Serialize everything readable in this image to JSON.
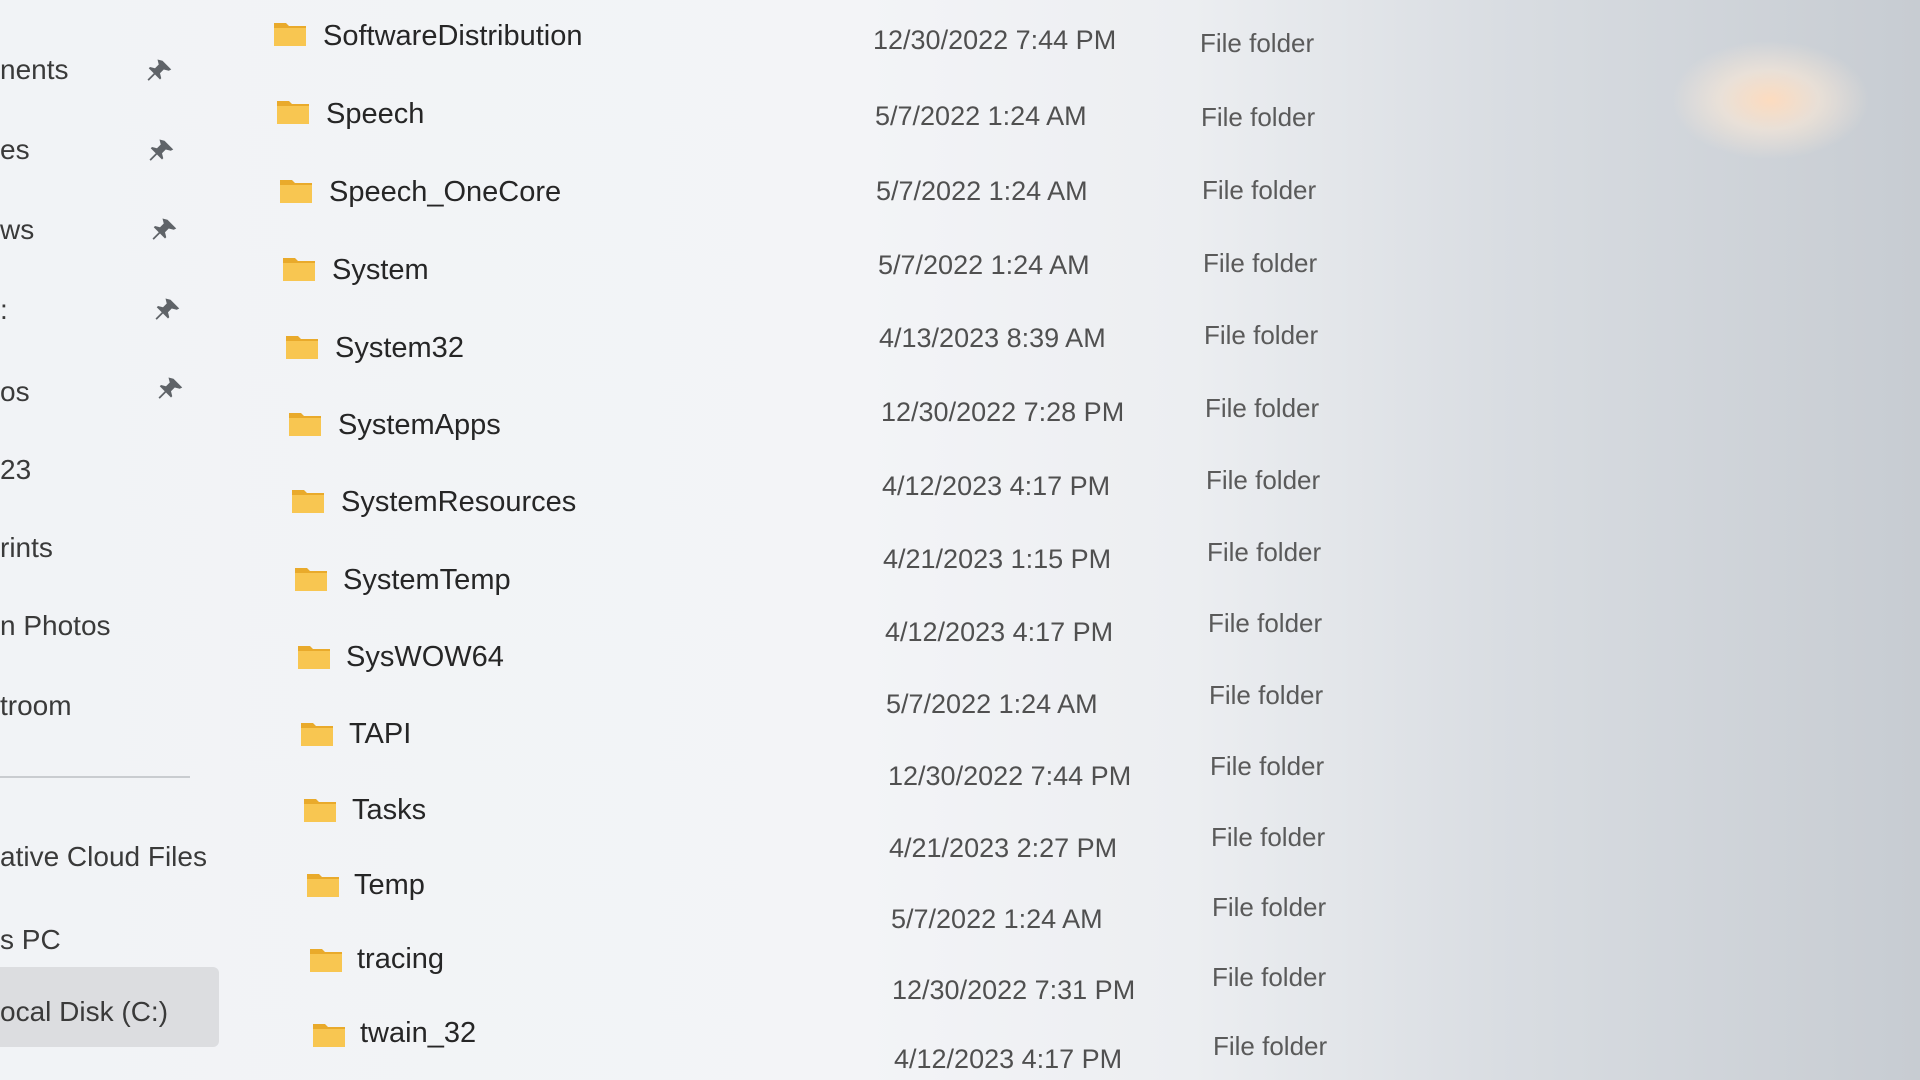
{
  "sidebar": {
    "items": [
      {
        "label": "nents",
        "pinned": true
      },
      {
        "label": "es",
        "pinned": true
      },
      {
        "label": "ws",
        "pinned": true
      },
      {
        "label": ":",
        "pinned": true
      },
      {
        "label": "os",
        "pinned": true
      },
      {
        "label": "23",
        "pinned": false
      },
      {
        "label": "rints",
        "pinned": false
      },
      {
        "label": "n Photos",
        "pinned": false
      },
      {
        "label": "troom",
        "pinned": false
      },
      {
        "label": "ative Cloud Files",
        "pinned": false
      },
      {
        "label": "s PC",
        "pinned": false
      },
      {
        "label": "ocal Disk (C:)",
        "pinned": false,
        "selected": true
      }
    ]
  },
  "files": [
    {
      "name": "SoftwareDistribution",
      "date": "12/30/2022 7:44 PM",
      "type": "File folder"
    },
    {
      "name": "Speech",
      "date": "5/7/2022 1:24 AM",
      "type": "File folder"
    },
    {
      "name": "Speech_OneCore",
      "date": "5/7/2022 1:24 AM",
      "type": "File folder"
    },
    {
      "name": "System",
      "date": "5/7/2022 1:24 AM",
      "type": "File folder"
    },
    {
      "name": "System32",
      "date": "4/13/2023 8:39 AM",
      "type": "File folder"
    },
    {
      "name": "SystemApps",
      "date": "12/30/2022 7:28 PM",
      "type": "File folder"
    },
    {
      "name": "SystemResources",
      "date": "4/12/2023 4:17 PM",
      "type": "File folder"
    },
    {
      "name": "SystemTemp",
      "date": "4/21/2023 1:15 PM",
      "type": "File folder"
    },
    {
      "name": "SysWOW64",
      "date": "4/12/2023 4:17 PM",
      "type": "File folder"
    },
    {
      "name": "TAPI",
      "date": "5/7/2022 1:24 AM",
      "type": "File folder"
    },
    {
      "name": "Tasks",
      "date": "12/30/2022 7:44 PM",
      "type": "File folder"
    },
    {
      "name": "Temp",
      "date": "4/21/2023 2:27 PM",
      "type": "File folder"
    },
    {
      "name": "tracing",
      "date": "5/7/2022 1:24 AM",
      "type": "File folder"
    },
    {
      "name": "twain_32",
      "date": "12/30/2022 7:31 PM",
      "type": "File folder"
    },
    {
      "name": "",
      "date": "4/12/2023 4:17 PM",
      "type": "File folder"
    }
  ],
  "colors": {
    "folder": "#f8c651",
    "folder_tab": "#e9aa2b",
    "pin": "#5f6368"
  },
  "icons": {
    "folder": "folder-icon",
    "pin": "pin-icon"
  }
}
